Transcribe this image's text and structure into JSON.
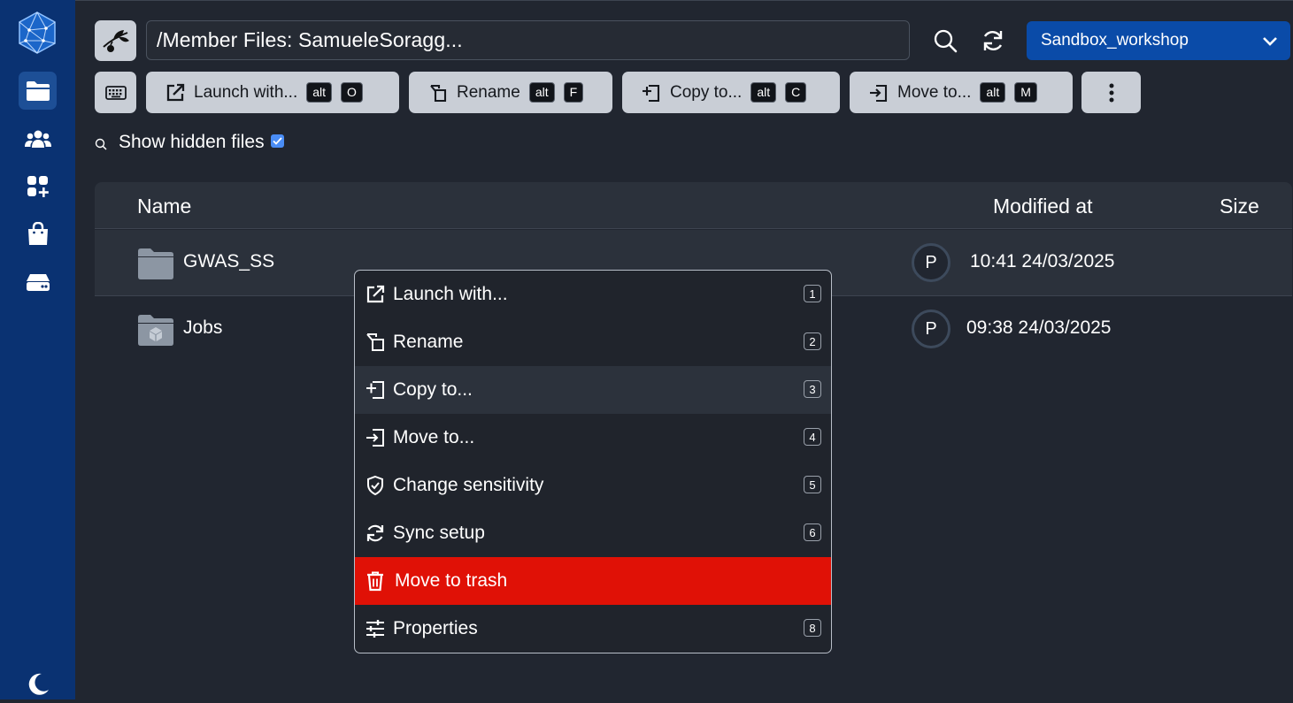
{
  "colors": {
    "sidebar_bg": "#0a3272",
    "page_bg": "#212630",
    "project_bg": "#0a4ba8",
    "danger": "#e01106",
    "toolbar_button_bg": "#c9ced6"
  },
  "sidebar": {
    "logo_icon": "ucloud-logo-icon",
    "items": [
      {
        "name": "files",
        "icon": "folder-icon",
        "active": true
      },
      {
        "name": "workspaces",
        "icon": "users-icon",
        "active": false
      },
      {
        "name": "apps",
        "icon": "apps-add-icon",
        "active": false
      },
      {
        "name": "store",
        "icon": "shopping-bag-icon",
        "active": false
      },
      {
        "name": "resources",
        "icon": "storage-drive-icon",
        "active": false
      }
    ],
    "theme_icon": "moon-icon"
  },
  "header": {
    "path": "/Member Files: SamueleSoragg...",
    "project": "Sandbox_workshop"
  },
  "toolbar": {
    "buttons": [
      {
        "label": "Launch with...",
        "keys": [
          "alt",
          "O"
        ],
        "icon": "external-link-icon"
      },
      {
        "label": "Rename",
        "keys": [
          "alt",
          "F"
        ],
        "icon": "rename-icon"
      },
      {
        "label": "Copy to...",
        "keys": [
          "alt",
          "C"
        ],
        "icon": "copy-to-icon"
      },
      {
        "label": "Move to...",
        "keys": [
          "alt",
          "M"
        ],
        "icon": "move-to-icon"
      }
    ]
  },
  "options": {
    "show_hidden_label": "Show hidden files",
    "show_hidden_checked": true
  },
  "table": {
    "columns": {
      "name": "Name",
      "modified": "Modified at",
      "size": "Size"
    },
    "rows": [
      {
        "name": "GWAS_SS",
        "avatar": "P",
        "modified": "10:41 24/03/2025",
        "selected": true,
        "icon": "folder-icon"
      },
      {
        "name": "Jobs",
        "avatar": "P",
        "modified": "09:38 24/03/2025",
        "selected": false,
        "icon": "jobs-folder-icon"
      }
    ]
  },
  "context_menu": {
    "items": [
      {
        "label": "Launch with...",
        "shortcut": "1",
        "icon": "external-link-icon"
      },
      {
        "label": "Rename",
        "shortcut": "2",
        "icon": "rename-icon"
      },
      {
        "label": "Copy to...",
        "shortcut": "3",
        "icon": "copy-to-icon"
      },
      {
        "label": "Move to...",
        "shortcut": "4",
        "icon": "move-to-icon"
      },
      {
        "label": "Change sensitivity",
        "shortcut": "5",
        "icon": "shield-check-icon"
      },
      {
        "label": "Sync setup",
        "shortcut": "6",
        "icon": "sync-icon"
      },
      {
        "label": "Move to trash",
        "shortcut": "",
        "icon": "trash-icon"
      },
      {
        "label": "Properties",
        "shortcut": "8",
        "icon": "sliders-icon"
      }
    ]
  }
}
